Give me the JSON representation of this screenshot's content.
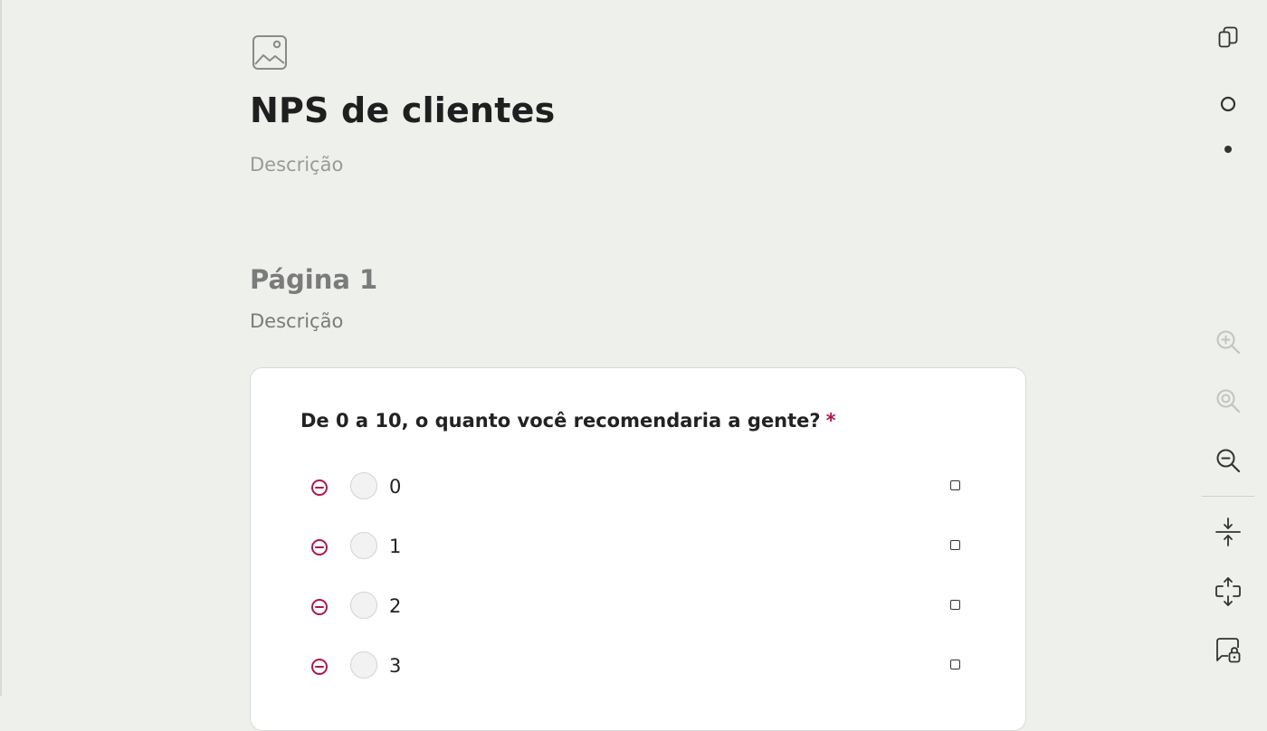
{
  "survey": {
    "title": "NPS de clientes",
    "description_placeholder": "Descrição"
  },
  "page": {
    "title": "Página 1",
    "description_placeholder": "Descrição"
  },
  "question": {
    "title": "De 0 a 10, o quanto você recomendaria a gente?",
    "required_mark": "*",
    "choices": [
      {
        "label": "0"
      },
      {
        "label": "1"
      },
      {
        "label": "2"
      },
      {
        "label": "3"
      }
    ]
  },
  "toolbar": {
    "icons": [
      "copy-icon",
      "circle-icon",
      "dot-icon",
      "zoom-in-icon",
      "zoom-reset-icon",
      "zoom-out-icon",
      "collapse-icon",
      "expand-icon",
      "lock-comment-icon"
    ]
  },
  "colors": {
    "background": "#eef0ec",
    "card": "#ffffff",
    "accent": "#b0174a",
    "muted_text": "#7b7b7b"
  }
}
